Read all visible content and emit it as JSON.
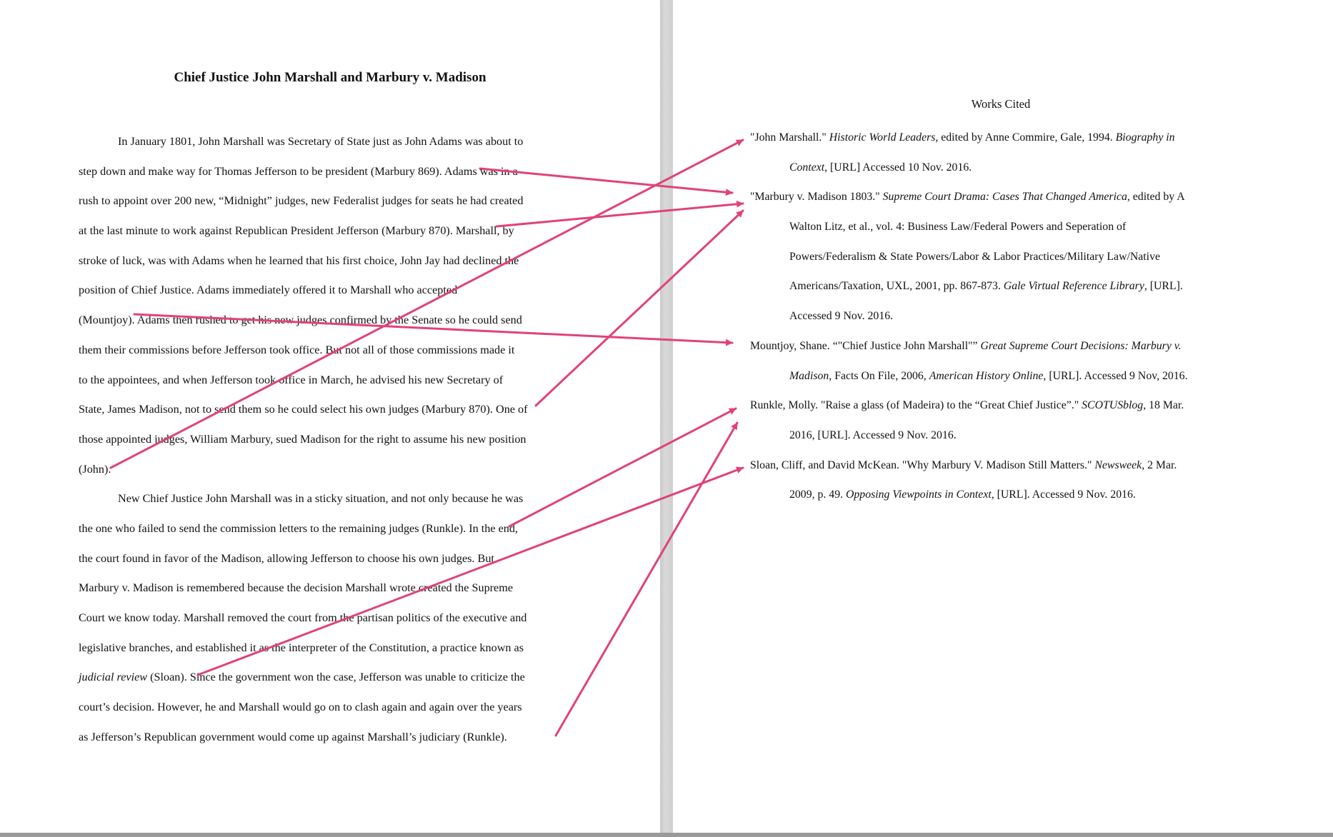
{
  "paper": {
    "title": "Chief Justice John Marshall and Marbury v. Madison",
    "body_lines": [
      {
        "text": "In January 1801, John Marshall was Secretary of State just as John Adams was about to",
        "indent": true
      },
      {
        "text": "step down and make way for Thomas Jefferson to be president (Marbury 869). Adams was in a"
      },
      {
        "text": "rush to appoint over 200 new, “Midnight” judges, new Federalist judges for seats he had created"
      },
      {
        "text": "at the last minute to work against Republican President Jefferson (Marbury 870). Marshall, by"
      },
      {
        "text": "stroke of luck, was with Adams when he learned that his first choice, John Jay had declined the"
      },
      {
        "text": "position of Chief Justice. Adams immediately offered it to Marshall who accepted"
      },
      {
        "text": "(Mountjoy). Adams then rushed to get his new judges confirmed by the Senate so he could send"
      },
      {
        "text": "them their commissions before Jefferson took office. But not all of those commissions made it"
      },
      {
        "text": "to the appointees, and when Jefferson took office in March, he advised his new Secretary of"
      },
      {
        "text": "State, James Madison, not to send them so he could select his own judges (Marbury 870). One of"
      },
      {
        "text": "those appointed judges, William Marbury, sued Madison for the right to assume his new position"
      },
      {
        "text": "(John)."
      },
      {
        "text": "New Chief Justice John Marshall was in a sticky situation, and not only because he was",
        "indent": true
      },
      {
        "text": "the one who failed to send the commission letters to the remaining judges (Runkle). In the end,"
      },
      {
        "text": "the court found in favor of the Madison, allowing Jefferson to choose his own judges. But"
      },
      {
        "text": "Marbury v. Madison is remembered because the decision Marshall wrote created the Supreme"
      },
      {
        "text": "Court we know today. Marshall removed the court from the partisan politics of the executive and"
      },
      {
        "text": "legislative branches, and established it as the interpreter of the Constitution, a practice known as"
      },
      {
        "text_italic": "judicial review",
        "text": " (Sloan). Since the government won the case, Jefferson was unable to criticize the"
      },
      {
        "text": "court’s decision. However, he and Marshall would go on to clash again and again over the years"
      },
      {
        "text": "as Jefferson’s Republican government would come up against Marshall’s judiciary (Runkle)."
      }
    ]
  },
  "works_cited": {
    "title": "Works Cited",
    "lines": [
      {
        "parts": [
          {
            "t": "\"John Marshall.\" "
          },
          {
            "t": "Historic World Leaders",
            "i": true
          },
          {
            "t": ", edited by Anne Commire, Gale, 1994. "
          },
          {
            "t": "Biography in",
            "i": true
          }
        ]
      },
      {
        "hang": true,
        "parts": [
          {
            "t": "Context",
            "i": true
          },
          {
            "t": ", [URL] Accessed 10 Nov. 2016."
          }
        ]
      },
      {
        "parts": [
          {
            "t": "\"Marbury v. Madison 1803.\" "
          },
          {
            "t": "Supreme Court Drama: Cases That Changed America",
            "i": true
          },
          {
            "t": ", edited by A"
          }
        ]
      },
      {
        "hang": true,
        "parts": [
          {
            "t": "Walton Litz, et al., vol. 4: Business Law/Federal Powers and Seperation of"
          }
        ]
      },
      {
        "hang": true,
        "parts": [
          {
            "t": "Powers/Federalism & State Powers/Labor & Labor Practices/Military Law/Native"
          }
        ]
      },
      {
        "hang": true,
        "parts": [
          {
            "t": "Americans/Taxation, UXL, 2001, pp. 867-873. "
          },
          {
            "t": "Gale Virtual Reference Library",
            "i": true
          },
          {
            "t": ", [URL]."
          }
        ]
      },
      {
        "hang": true,
        "parts": [
          {
            "t": "Accessed 9 Nov. 2016."
          }
        ]
      },
      {
        "parts": [
          {
            "t": "Mountjoy, Shane. “\"Chief Justice John Marshall\"” "
          },
          {
            "t": "Great Supreme Court Decisions: Marbury v.",
            "i": true
          }
        ]
      },
      {
        "hang": true,
        "parts": [
          {
            "t": "Madison",
            "i": true
          },
          {
            "t": ", Facts On File, 2006, "
          },
          {
            "t": "American History Online",
            "i": true
          },
          {
            "t": ", [URL]. Accessed 9 Nov, 2016."
          }
        ]
      },
      {
        "parts": [
          {
            "t": "Runkle, Molly. \"Raise a glass (of Madeira) to the “Great Chief Justice”.\" "
          },
          {
            "t": "SCOTUSblog",
            "i": true
          },
          {
            "t": ", 18 Mar."
          }
        ]
      },
      {
        "hang": true,
        "parts": [
          {
            "t": "2016, [URL]. Accessed 9 Nov. 2016."
          }
        ]
      },
      {
        "parts": [
          {
            "t": "Sloan, Cliff, and David McKean. \"Why Marbury V. Madison Still Matters.\" "
          },
          {
            "t": "Newsweek",
            "i": true
          },
          {
            "t": ", 2 Mar."
          }
        ]
      },
      {
        "hang": true,
        "parts": [
          {
            "t": "2009, p. 49. "
          },
          {
            "t": "Opposing Viewpoints in Context",
            "i": true
          },
          {
            "t": ", [URL]. Accessed 9 Nov. 2016."
          }
        ]
      }
    ]
  },
  "annotation_color": "#e0427a"
}
